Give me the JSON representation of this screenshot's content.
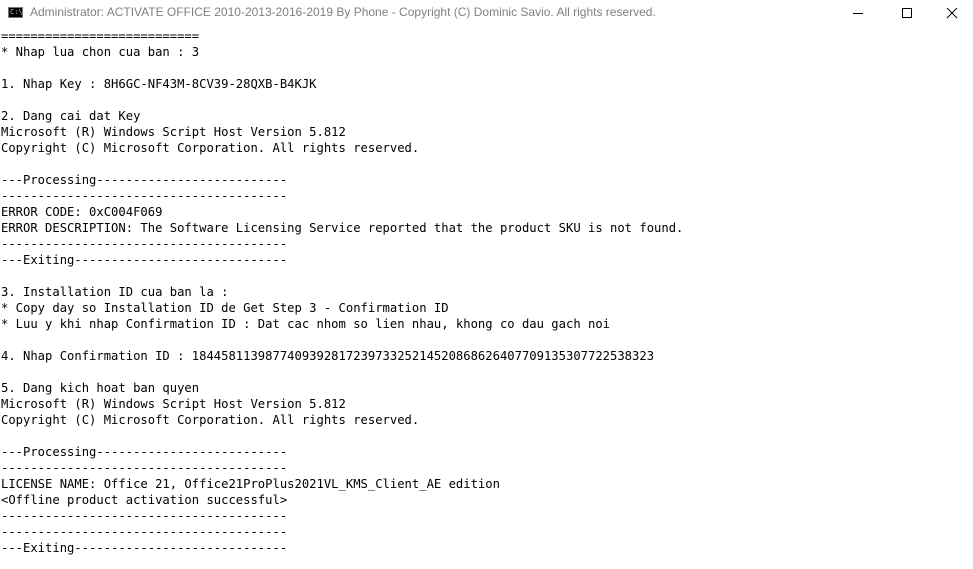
{
  "window": {
    "title": "Administrator:  ACTIVATE OFFICE 2010-2013-2016-2019 By Phone - Copyright (C) Dominic Savio. All rights reserved.",
    "icon": "cmd-icon",
    "icon_label": "C:\\"
  },
  "controls": {
    "minimize": "minimize-icon",
    "maximize": "maximize-icon",
    "close": "close-icon"
  },
  "console": {
    "lines": [
      "===========================",
      "* Nhap lua chon cua ban : 3",
      "",
      "1. Nhap Key : 8H6GC-NF43M-8CV39-28QXB-B4KJK",
      "",
      "2. Dang cai dat Key",
      "Microsoft (R) Windows Script Host Version 5.812",
      "Copyright (C) Microsoft Corporation. All rights reserved.",
      "",
      "---Processing--------------------------",
      "---------------------------------------",
      "ERROR CODE: 0xC004F069",
      "ERROR DESCRIPTION: The Software Licensing Service reported that the product SKU is not found.",
      "---------------------------------------",
      "---Exiting-----------------------------",
      "",
      "3. Installation ID cua ban la :",
      "* Copy day so Installation ID de Get Step 3 - Confirmation ID",
      "* Luu y khi nhap Confirmation ID : Dat cac nhom so lien nhau, khong co dau gach noi",
      "",
      "4. Nhap Confirmation ID : 184458113987740939281723973325214520868626407709135307722538323",
      "",
      "5. Dang kich hoat ban quyen",
      "Microsoft (R) Windows Script Host Version 5.812",
      "Copyright (C) Microsoft Corporation. All rights reserved.",
      "",
      "---Processing--------------------------",
      "---------------------------------------",
      "LICENSE NAME: Office 21, Office21ProPlus2021VL_KMS_Client_AE edition",
      "<Offline product activation successful>",
      "---------------------------------------",
      "---------------------------------------",
      "---Exiting-----------------------------"
    ]
  }
}
